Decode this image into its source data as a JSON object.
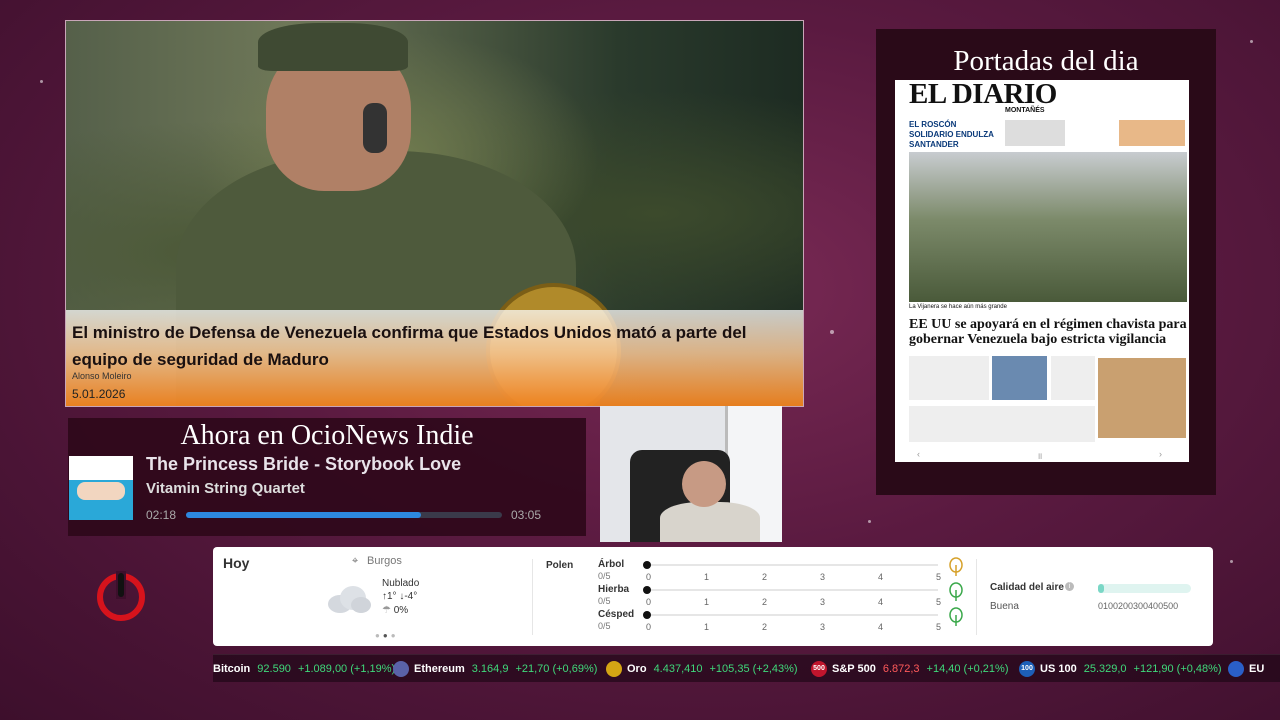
{
  "news": {
    "title": "El ministro de Defensa de Venezuela confirma que Estados Unidos mató a parte del equipo de seguridad de Maduro",
    "author": "Alonso Moleiro",
    "date": "5.01.2026"
  },
  "newspaper": {
    "heading": "Portadas del dia",
    "masthead": "EL DIARIO",
    "subtitle": "MONTAÑÉS",
    "teaser": "EL ROSCÓN SOLIDARIO ENDULZA SANTANDER",
    "photo_caption": "La Vijanera se hace aún más grande",
    "headline": "EE UU se apoyará en el régimen chavista para gobernar Venezuela bajo estricta vigilancia"
  },
  "now_playing": {
    "heading": "Ahora en OcioNews Indie",
    "title": "The Princess Bride - Storybook Love",
    "artist": "Vitamin String Quartet",
    "elapsed": "02:18",
    "total": "03:05",
    "progress": 0.745
  },
  "weather": {
    "label": "Hoy",
    "location": "Burgos",
    "condition": "Nublado",
    "temps": "↑1° ↓-4°",
    "rain": "0%",
    "polen_label": "Polen",
    "pollen": [
      {
        "name": "Árbol",
        "score": "0/5",
        "icon": "tree-icon",
        "color": "#d6a12a"
      },
      {
        "name": "Hierba",
        "score": "0/5",
        "icon": "herb-icon",
        "color": "#3aa84a"
      },
      {
        "name": "Césped",
        "score": "0/5",
        "icon": "grass-icon",
        "color": "#3aa84a"
      }
    ],
    "scale": [
      "0",
      "1",
      "2",
      "3",
      "4",
      "5"
    ],
    "air_quality_label": "Calidad del aire",
    "air_quality_status": "Buena",
    "air_quality_scale": "0100200300400500",
    "air_quality_value": 0
  },
  "ticker": [
    {
      "name": "Bitcoin",
      "price": "92.590",
      "change": "+1.089,00 (+1,19%)",
      "direction": "up",
      "icon": "bitcoin-icon",
      "icon_color": "#f7931a"
    },
    {
      "name": "Ethereum",
      "price": "3.164,9",
      "change": "+21,70 (+0,69%)",
      "direction": "up",
      "icon": "ethereum-icon",
      "icon_color": "#5a62a8"
    },
    {
      "name": "Oro",
      "price": "4.437,410",
      "change": "+105,35 (+2,43%)",
      "direction": "up",
      "icon": "gold-icon",
      "icon_color": "#d4a514"
    },
    {
      "name": "S&P 500",
      "price": "6.872,3",
      "change": "+14,40 (+0,21%)",
      "direction": "up",
      "icon_text": "500",
      "icon": "sp500-icon",
      "icon_color": "#c0152d"
    },
    {
      "name": "US 100",
      "price": "25.329,0",
      "change": "+121,90 (+0,48%)",
      "direction": "up",
      "icon_text": "100",
      "icon": "us100-icon",
      "icon_color": "#1d5fb8"
    },
    {
      "name": "EU",
      "price": "",
      "change": "",
      "direction": "neutral",
      "icon": "eu-flag-icon",
      "icon_color": "#2a5fc8"
    }
  ],
  "colors": {
    "accent_orange": "#f08a22",
    "progress_blue": "#2d88e0",
    "power_red": "#d6131c",
    "up": "#3fd97a",
    "down": "#ff5a5a"
  }
}
